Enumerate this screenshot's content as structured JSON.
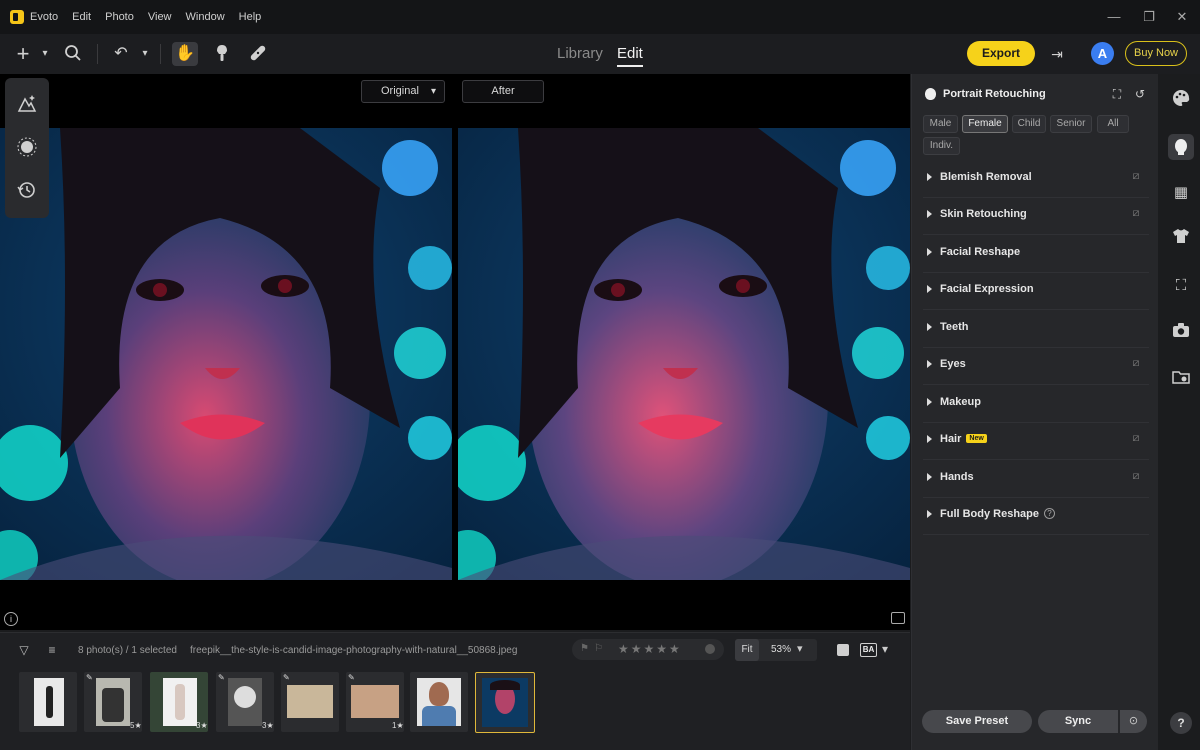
{
  "app": {
    "name": "Evoto"
  },
  "menu": [
    "Edit",
    "Photo",
    "View",
    "Window",
    "Help"
  ],
  "tabs": {
    "library": "Library",
    "edit": "Edit"
  },
  "toolbar": {
    "export_label": "Export",
    "buy_label": "Buy Now",
    "avatar_letter": "A"
  },
  "compare": {
    "original_label": "Original",
    "after_label": "After"
  },
  "filmstrip": {
    "info": "8 photo(s) / 1 selected",
    "filename": "freepik__the-style-is-candid-image-photography-with-natural__50868.jpeg",
    "fit_label": "Fit",
    "zoom": "53%",
    "ba_label": "BA",
    "thumbnails": [
      {
        "badge": ""
      },
      {
        "badge": "5★"
      },
      {
        "badge": "3★"
      },
      {
        "badge": "3★"
      },
      {
        "badge": ""
      },
      {
        "badge": "1★"
      },
      {
        "badge": ""
      },
      {
        "badge": ""
      }
    ]
  },
  "panel": {
    "title": "Portrait Retouching",
    "chips": [
      "Male",
      "Female",
      "Child",
      "Senior",
      "All",
      "Indiv."
    ],
    "active_chip": "Female",
    "sections": [
      {
        "label": "Blemish Removal",
        "edit": true
      },
      {
        "label": "Skin Retouching",
        "edit": true
      },
      {
        "label": "Facial Reshape",
        "edit": false
      },
      {
        "label": "Facial Expression",
        "edit": false
      },
      {
        "label": "Teeth",
        "edit": false
      },
      {
        "label": "Eyes",
        "edit": true
      },
      {
        "label": "Makeup",
        "edit": false
      },
      {
        "label": "Hair",
        "edit": true,
        "badge": "New"
      },
      {
        "label": "Hands",
        "edit": true
      },
      {
        "label": "Full Body Reshape",
        "edit": false
      }
    ],
    "save_preset_label": "Save Preset",
    "sync_label": "Sync"
  },
  "rail": {
    "help_label": "?"
  },
  "colors": {
    "accent": "#f6d21a",
    "avatar": "#3a7df0",
    "selected_thumb": "#e0b83a"
  }
}
